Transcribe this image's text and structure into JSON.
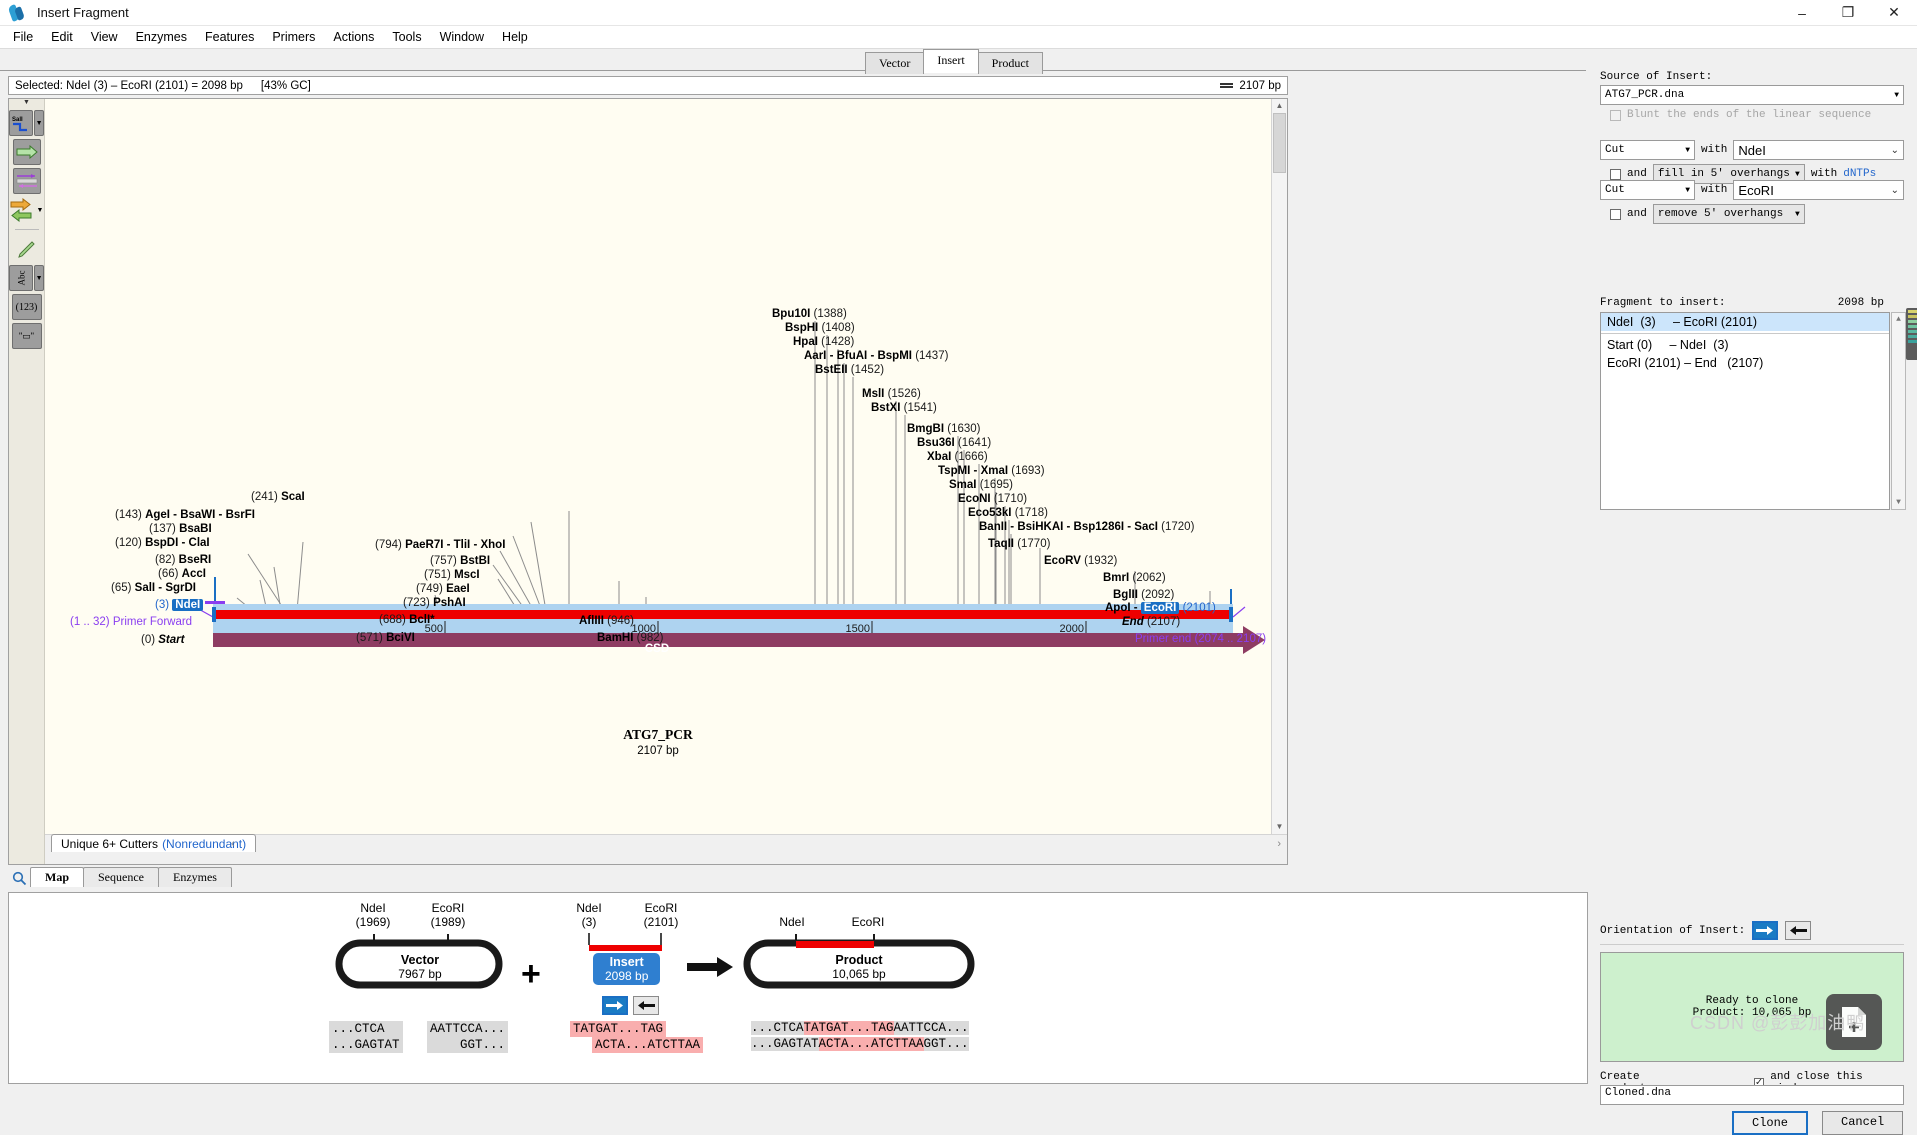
{
  "window": {
    "title": "Insert Fragment",
    "icon": "dna-icon",
    "minimize": "–",
    "maximize": "❐",
    "close": "✕"
  },
  "menu": [
    "File",
    "Edit",
    "View",
    "Enzymes",
    "Features",
    "Primers",
    "Actions",
    "Tools",
    "Window",
    "Help"
  ],
  "tabs": {
    "items": [
      {
        "label": "Vector",
        "active": false
      },
      {
        "label": "Insert",
        "active": true
      },
      {
        "label": "Product",
        "active": false
      }
    ]
  },
  "selection_bar": {
    "text": "Selected: NdeI (3) – EcoRI (2101) = 2098 bp",
    "gc": "[43% GC]",
    "length_icon": "double-line-icon",
    "length": "2107 bp"
  },
  "map": {
    "sequence_name": "ATG7_PCR",
    "sequence_length": "2107 bp",
    "feature_name": "CSD",
    "ruler_ticks": [
      "500",
      "1000",
      "1500",
      "2000"
    ],
    "cutter_tab": "Unique 6+ Cutters",
    "cutter_tab_note": "(Nonredundant)",
    "toolbar": [
      {
        "name": "enzyme-tool",
        "label": "SalI"
      },
      {
        "name": "feature-arrow-tool",
        "label": ""
      },
      {
        "name": "primer-tool",
        "label": ""
      },
      {
        "name": "orientation-tool",
        "label": ""
      },
      {
        "name": "highlight-pen-tool",
        "label": ""
      },
      {
        "name": "text-tool",
        "label": "Abc"
      },
      {
        "name": "number-tool",
        "label": "(123)"
      },
      {
        "name": "ruler-tool",
        "label": "\"▭\""
      }
    ],
    "labels_left": [
      {
        "pos": "(241)",
        "enz": "ScaI",
        "posFirst": true
      },
      {
        "pos": "(143)",
        "enz": "AgeI - BsaWI - BsrFI",
        "posFirst": true
      },
      {
        "pos": "(137)",
        "enz": "BsaBI",
        "posFirst": true
      },
      {
        "pos": "(120)",
        "enz": "BspDI - ClaI",
        "posFirst": true
      },
      {
        "pos": "(82)",
        "enz": "BseRI",
        "posFirst": true
      },
      {
        "pos": "(66)",
        "enz": "AccI",
        "posFirst": true
      },
      {
        "pos": "(65)",
        "enz": "SalI - SgrDI",
        "posFirst": true
      }
    ],
    "labels_mid": [
      {
        "pos": "(794)",
        "enz": "PaeR7I - TliI - XhoI",
        "posFirst": true
      },
      {
        "pos": "(757)",
        "enz": "BstBI",
        "posFirst": true
      },
      {
        "pos": "(751)",
        "enz": "MscI",
        "posFirst": true
      },
      {
        "pos": "(749)",
        "enz": "EaeI",
        "posFirst": true
      },
      {
        "pos": "(723)",
        "enz": "PshAI",
        "posFirst": true
      },
      {
        "pos": "(688)",
        "enz": "BclI*",
        "posFirst": true
      },
      {
        "pos": "(571)",
        "enz": "BciVI",
        "posFirst": true
      },
      {
        "pos": "(946)",
        "enz": "AflIII",
        "posFirst": false
      },
      {
        "pos": "(982)",
        "enz": "BamHI",
        "posFirst": false
      }
    ],
    "labels_right": [
      {
        "pos": "(1388)",
        "enz": "Bpu10I",
        "posFirst": false
      },
      {
        "pos": "(1408)",
        "enz": "BspHI",
        "posFirst": false
      },
      {
        "pos": "(1428)",
        "enz": "HpaI",
        "posFirst": false
      },
      {
        "pos": "(1437)",
        "enz": "AarI - BfuAI - BspMI",
        "posFirst": false
      },
      {
        "pos": "(1452)",
        "enz": "BstEII",
        "posFirst": false
      },
      {
        "pos": "(1526)",
        "enz": "MslI",
        "posFirst": false
      },
      {
        "pos": "(1541)",
        "enz": "BstXI",
        "posFirst": false
      },
      {
        "pos": "(1630)",
        "enz": "BmgBI",
        "posFirst": false
      },
      {
        "pos": "(1641)",
        "enz": "Bsu36I",
        "posFirst": false
      },
      {
        "pos": "(1666)",
        "enz": "XbaI",
        "posFirst": false
      },
      {
        "pos": "(1693)",
        "enz": "TspMI - XmaI",
        "posFirst": false
      },
      {
        "pos": "(1695)",
        "enz": "SmaI",
        "posFirst": false
      },
      {
        "pos": "(1710)",
        "enz": "EcoNI",
        "posFirst": false
      },
      {
        "pos": "(1718)",
        "enz": "Eco53kI",
        "posFirst": false
      },
      {
        "pos": "(1720)",
        "enz": "BanII - BsiHKAI - Bsp1286I - SacI",
        "posFirst": false
      },
      {
        "pos": "(1770)",
        "enz": "TaqII",
        "posFirst": false
      },
      {
        "pos": "(1932)",
        "enz": "EcoRV",
        "posFirst": false
      },
      {
        "pos": "(2062)",
        "enz": "BmrI",
        "posFirst": false
      },
      {
        "pos": "(2092)",
        "enz": "BglII",
        "posFirst": false
      }
    ],
    "special": {
      "ndei_pos": "(3)",
      "ndei_name": "NdeI",
      "primer_forward_range": "(1 .. 32)",
      "primer_forward_name": "Primer Forward",
      "start_pos": "(0)",
      "start_name": "Start",
      "apoi_name": "ApoI -",
      "ecori_name": "EcoRI",
      "ecori_pos": "(2101)",
      "end_name": "End",
      "end_pos": "(2107)",
      "primer_end_name": "Primer end",
      "primer_end_range": "(2074 .. 2107)"
    }
  },
  "map_bottom_tabs": [
    {
      "label": "Map",
      "active": true
    },
    {
      "label": "Sequence",
      "active": false
    },
    {
      "label": "Enzymes",
      "active": false
    }
  ],
  "diagram": {
    "vector": {
      "left_enzyme": "NdeI",
      "left_pos": "(1969)",
      "right_enzyme": "EcoRI",
      "right_pos": "(1989)",
      "title": "Vector",
      "size": "7967 bp",
      "seq_left_top": "...CTCA",
      "seq_left_bottom": "...GAGTAT",
      "seq_right_top": "AATTCCA...",
      "seq_right_bottom": "GGT..."
    },
    "plus": "+",
    "insert": {
      "left_enzyme": "NdeI",
      "left_pos": "(3)",
      "right_enzyme": "EcoRI",
      "right_pos": "(2101)",
      "title": "Insert",
      "size": "2098 bp",
      "seq_top": "TATGAT...TAG",
      "seq_bottom": "ACTA...ATCTTAA",
      "orientation_forward": "➜",
      "orientation_reverse": "⬅"
    },
    "arrow": "➜",
    "product": {
      "left_enzyme": "NdeI",
      "right_enzyme": "EcoRI",
      "title": "Product",
      "size": "10,065 bp",
      "seq_top_pre": "...CTCA",
      "seq_top_ins": "TATGAT...TAG",
      "seq_top_post": "AATTCCA...",
      "seq_bottom_pre": "...GAGTAT",
      "seq_bottom_ins": "ACTA...ATCTTAA",
      "seq_bottom_post": "GGT..."
    }
  },
  "sidebar": {
    "source_label": "Source of Insert:",
    "source_value": "ATG7_PCR.dna",
    "blunt_label": "Blunt the ends of the linear sequence",
    "cut1": {
      "action": "Cut",
      "with_label": "with",
      "enzyme": "NdeI",
      "and_label": "and",
      "modifier": "fill in 5' overhangs",
      "with2_label": "with",
      "dntps": "dNTPs"
    },
    "cut2": {
      "action": "Cut",
      "with_label": "with",
      "enzyme": "EcoRI",
      "and_label": "and",
      "modifier": "remove 5' overhangs"
    },
    "fragment_label": "Fragment to insert:",
    "fragment_size": "2098 bp",
    "fragment_rows": [
      {
        "text": "NdeI  (3)     – EcoRI (2101)",
        "selected": true
      },
      {
        "text": "Start (0)     – NdeI  (3)",
        "selected": false
      },
      {
        "text": "EcoRI (2101) – End   (2107)",
        "selected": false
      }
    ],
    "orientation_label": "Orientation of Insert:",
    "ready_line1": "Ready to clone",
    "ready_line2": "Product:  10,065 bp",
    "create_product_label": "Create product:",
    "and_close_label": "and close this window",
    "product_filename": "Cloned.dna",
    "clone_button": "Clone",
    "cancel_button": "Cancel",
    "float_icon": "new-document-icon"
  },
  "watermark": "CSDN @彭彭加油鸭",
  "colors": {
    "insert_blue": "#1a6fc4",
    "insert_red": "#ee0000",
    "feature_purple": "#8e3c62",
    "backbone_blue": "#aed3f0",
    "ready_green": "#cdf0cd",
    "highlight_pink": "#f9aeae",
    "primer_purple": "#8a3ef0"
  }
}
